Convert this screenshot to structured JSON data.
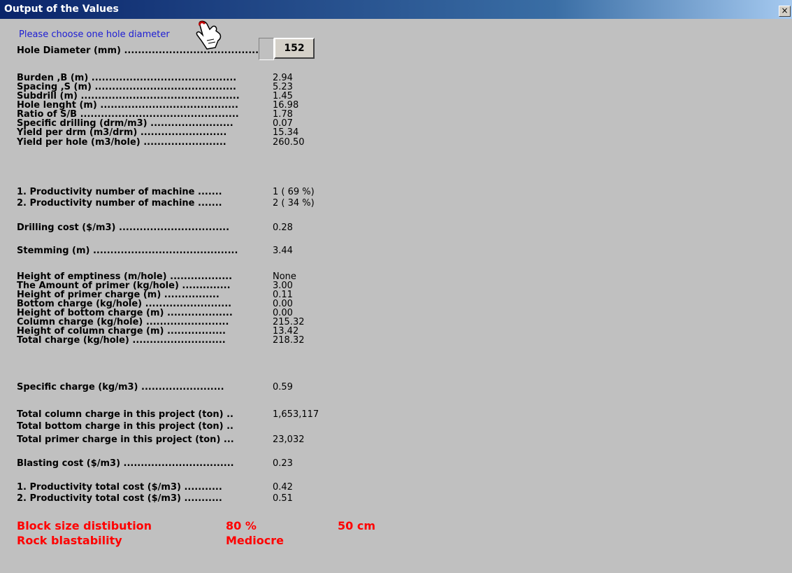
{
  "window": {
    "title": "Output of the Values",
    "close_glyph": "×"
  },
  "prompt": "Please choose one hole diameter",
  "hole_diameter": {
    "label": "Hole Diameter (mm) .........................................",
    "value": "152"
  },
  "rows": [
    {
      "label": "Burden ,B (m) ..........................................",
      "value": "2.94"
    },
    {
      "label": "Spacing ,S (m) .........................................",
      "value": "5.23"
    },
    {
      "label": "Subdrill (m) ..............................................",
      "value": "1.45"
    },
    {
      "label": "Hole lenght (m) ........................................",
      "value": "16.98"
    },
    {
      "label": "Ratio of S/B ..............................................",
      "value": "1.78"
    },
    {
      "label": "Specific drilling (drm/m3) ........................",
      "value": "0.07"
    },
    {
      "label": "Yield per drm (m3/drm) .........................",
      "value": "15.34"
    },
    {
      "label": "Yield per hole (m3/hole) ........................",
      "value": "260.50"
    },
    {
      "label": "1. Productivity number of machine .......",
      "value": "1  ( 69  %)"
    },
    {
      "label": "2. Productivity number of machine .......",
      "value": "2  ( 34  %)"
    },
    {
      "label": "Drilling cost ($/m3) ................................",
      "value": "0.28"
    },
    {
      "label": "Stemming (m) ..........................................",
      "value": "3.44"
    },
    {
      "label": "Height of emptiness (m/hole) ..................",
      "value": "None"
    },
    {
      "label": "The Amount of primer (kg/hole) ..............",
      "value": "3.00"
    },
    {
      "label": "Height of primer charge (m) ................",
      "value": "0.11"
    },
    {
      "label": "Bottom charge (kg/hole) .........................",
      "value": "0.00"
    },
    {
      "label": "Height of bottom charge (m) ...................",
      "value": "0.00"
    },
    {
      "label": "Column charge (kg/hole) ........................",
      "value": "215.32"
    },
    {
      "label": "Height of column charge (m) .................",
      "value": "13.42"
    },
    {
      "label": "Total charge (kg/hole) ...........................",
      "value": "218.32"
    },
    {
      "label": "Specific charge (kg/m3) ........................",
      "value": "0.59"
    },
    {
      "label": "Total column charge in this project (ton) ..",
      "value": "1,653,117"
    },
    {
      "label": "Total bottom charge in this project (ton) ..",
      "value": ""
    },
    {
      "label": "Total primer charge in this project (ton) ...",
      "value": "23,032"
    },
    {
      "label": "Blasting cost ($/m3) ................................",
      "value": "0.23"
    },
    {
      "label": "1. Productivity total cost ($/m3) ...........",
      "value": "0.42"
    },
    {
      "label": "2. Productivity total cost ($/m3) ...........",
      "value": "0.51"
    }
  ],
  "results": {
    "block_label": "Block size distibution",
    "block_percent": "80 %",
    "block_size": "50 cm",
    "rock_label": "Rock blastability",
    "rock_value": "Mediocre"
  }
}
